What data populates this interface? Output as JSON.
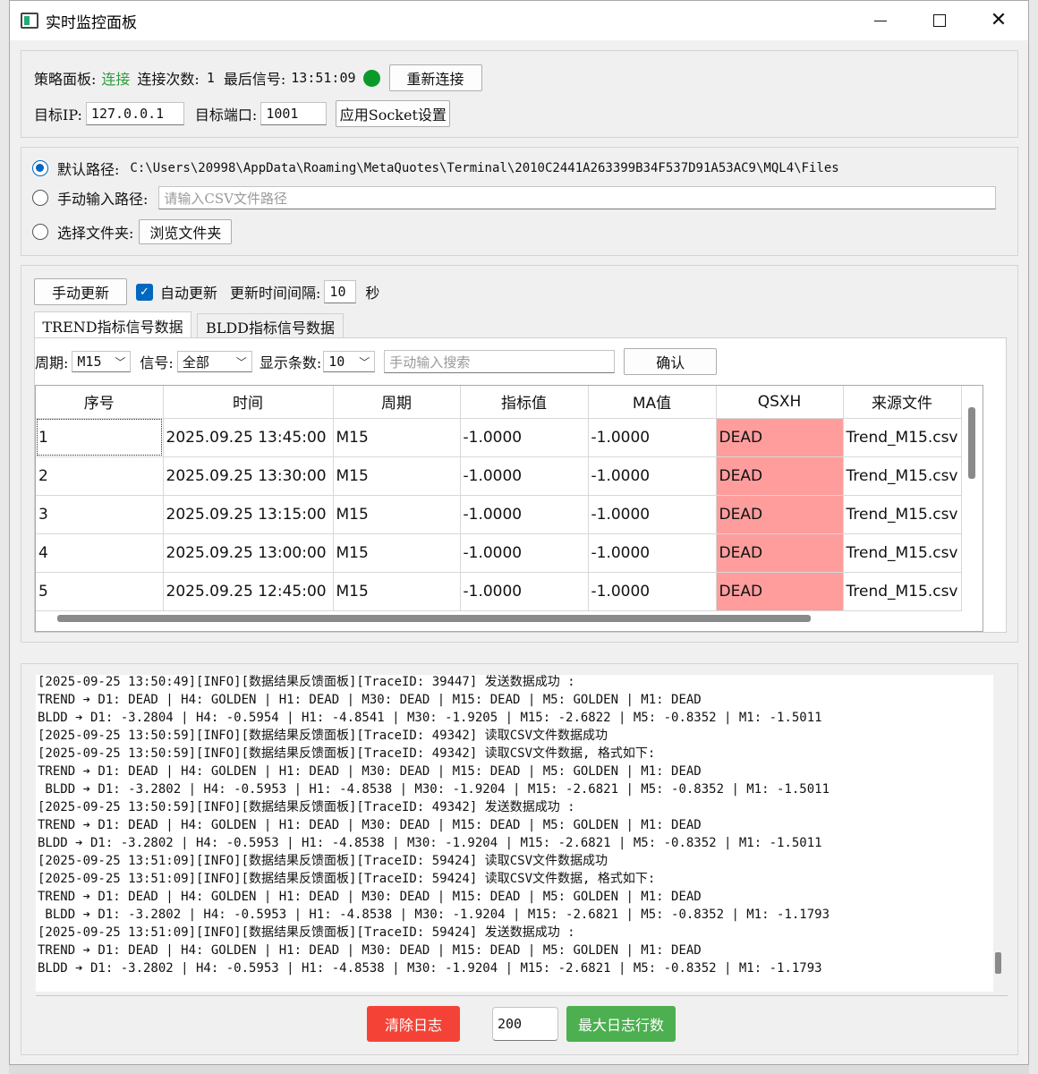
{
  "window": {
    "title": "实时监控面板"
  },
  "connection": {
    "panel_label": "策略面板:",
    "status": "连接",
    "status_color": "#2e9e3e",
    "count_label": "连接次数:",
    "count": "1",
    "last_signal_label": "最后信号:",
    "last_signal_time": "13:51:09",
    "reconnect_label": "重新连接",
    "ip_label": "目标IP:",
    "ip_value": "127.0.0.1",
    "port_label": "目标端口:",
    "port_value": "1001",
    "apply_label": "应用Socket设置"
  },
  "path": {
    "default_label": "默认路径:",
    "default_value": "C:\\Users\\20998\\AppData\\Roaming\\MetaQuotes\\Terminal\\2010C2441A263399B34F537D91A53AC9\\MQL4\\Files",
    "manual_label": "手动输入路径:",
    "manual_placeholder": "请输入CSV文件路径",
    "folder_label": "选择文件夹:",
    "browse_label": "浏览文件夹"
  },
  "update": {
    "manual_label": "手动更新",
    "auto_label": "自动更新",
    "interval_label": "更新时间间隔:",
    "interval_value": "10",
    "unit": "秒"
  },
  "tabs": [
    {
      "label": "TREND指标信号数据"
    },
    {
      "label": "BLDD指标信号数据"
    }
  ],
  "filters": {
    "period_label": "周期:",
    "period_value": "M15",
    "signal_label": "信号:",
    "signal_value": "全部",
    "count_label": "显示条数:",
    "count_value": "10",
    "search_placeholder": "手动输入搜索",
    "confirm_label": "确认"
  },
  "table": {
    "columns": [
      "序号",
      "时间",
      "周期",
      "指标值",
      "MA值",
      "QSXH",
      "来源文件"
    ],
    "rows": [
      [
        "1",
        "2025.09.25 13:45:00",
        "M15",
        "-1.0000",
        "-1.0000",
        "DEAD",
        "Trend_M15.csv"
      ],
      [
        "2",
        "2025.09.25 13:30:00",
        "M15",
        "-1.0000",
        "-1.0000",
        "DEAD",
        "Trend_M15.csv"
      ],
      [
        "3",
        "2025.09.25 13:15:00",
        "M15",
        "-1.0000",
        "-1.0000",
        "DEAD",
        "Trend_M15.csv"
      ],
      [
        "4",
        "2025.09.25 13:00:00",
        "M15",
        "-1.0000",
        "-1.0000",
        "DEAD",
        "Trend_M15.csv"
      ],
      [
        "5",
        "2025.09.25 12:45:00",
        "M15",
        "-1.0000",
        "-1.0000",
        "DEAD",
        "Trend_M15.csv"
      ]
    ],
    "dead_color": "#ff9d9d"
  },
  "log": {
    "lines": [
      "[2025-09-25 13:50:49][INFO][数据结果反馈面板][TraceID: 39447] 发送数据成功 :",
      "TREND ➔ D1: DEAD | H4: GOLDEN | H1: DEAD | M30: DEAD | M15: DEAD | M5: GOLDEN | M1: DEAD",
      "BLDD ➔ D1: -3.2804 | H4: -0.5954 | H1: -4.8541 | M30: -1.9205 | M15: -2.6822 | M5: -0.8352 | M1: -1.5011",
      "[2025-09-25 13:50:59][INFO][数据结果反馈面板][TraceID: 49342] 读取CSV文件数据成功",
      "[2025-09-25 13:50:59][INFO][数据结果反馈面板][TraceID: 49342] 读取CSV文件数据, 格式如下:",
      "TREND ➔ D1: DEAD | H4: GOLDEN | H1: DEAD | M30: DEAD | M15: DEAD | M5: GOLDEN | M1: DEAD",
      " BLDD ➔ D1: -3.2802 | H4: -0.5953 | H1: -4.8538 | M30: -1.9204 | M15: -2.6821 | M5: -0.8352 | M1: -1.5011",
      "[2025-09-25 13:50:59][INFO][数据结果反馈面板][TraceID: 49342] 发送数据成功 :",
      "TREND ➔ D1: DEAD | H4: GOLDEN | H1: DEAD | M30: DEAD | M15: DEAD | M5: GOLDEN | M1: DEAD",
      "BLDD ➔ D1: -3.2802 | H4: -0.5953 | H1: -4.8538 | M30: -1.9204 | M15: -2.6821 | M5: -0.8352 | M1: -1.5011",
      "[2025-09-25 13:51:09][INFO][数据结果反馈面板][TraceID: 59424] 读取CSV文件数据成功",
      "[2025-09-25 13:51:09][INFO][数据结果反馈面板][TraceID: 59424] 读取CSV文件数据, 格式如下:",
      "TREND ➔ D1: DEAD | H4: GOLDEN | H1: DEAD | M30: DEAD | M15: DEAD | M5: GOLDEN | M1: DEAD",
      " BLDD ➔ D1: -3.2802 | H4: -0.5953 | H1: -4.8538 | M30: -1.9204 | M15: -2.6821 | M5: -0.8352 | M1: -1.1793",
      "[2025-09-25 13:51:09][INFO][数据结果反馈面板][TraceID: 59424] 发送数据成功 :",
      "TREND ➔ D1: DEAD | H4: GOLDEN | H1: DEAD | M30: DEAD | M15: DEAD | M5: GOLDEN | M1: DEAD",
      "BLDD ➔ D1: -3.2802 | H4: -0.5953 | H1: -4.8538 | M30: -1.9204 | M15: -2.6821 | M5: -0.8352 | M1: -1.1793"
    ],
    "clear_label": "清除日志",
    "max_lines_value": "200",
    "max_lines_label": "最大日志行数"
  }
}
